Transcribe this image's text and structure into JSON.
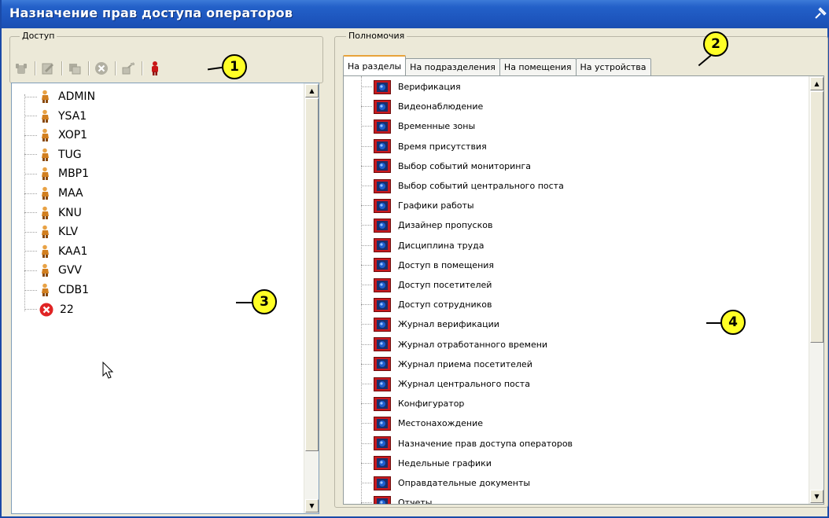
{
  "window": {
    "title": "Назначение прав доступа операторов"
  },
  "access_group": {
    "legend": "Доступ",
    "toolbar": [
      {
        "icon": "add-operator-icon",
        "enabled": false
      },
      {
        "icon": "edit-operator-icon",
        "enabled": false
      },
      {
        "icon": "copy-rights-icon",
        "enabled": false
      },
      {
        "icon": "delete-icon",
        "enabled": false
      },
      {
        "icon": "password-icon",
        "enabled": false
      },
      {
        "icon": "operator-red-icon",
        "enabled": true
      }
    ],
    "operators": [
      {
        "name": "ADMIN",
        "icon": "operator-icon"
      },
      {
        "name": "YSA1",
        "icon": "operator-icon"
      },
      {
        "name": "XOP1",
        "icon": "operator-icon"
      },
      {
        "name": "TUG",
        "icon": "operator-icon"
      },
      {
        "name": "MBP1",
        "icon": "operator-icon"
      },
      {
        "name": "MAA",
        "icon": "operator-icon"
      },
      {
        "name": "KNU",
        "icon": "operator-icon"
      },
      {
        "name": "KLV",
        "icon": "operator-icon"
      },
      {
        "name": "KAA1",
        "icon": "operator-icon"
      },
      {
        "name": "GVV",
        "icon": "operator-icon"
      },
      {
        "name": "CDB1",
        "icon": "operator-icon"
      },
      {
        "name": "22",
        "icon": "error-icon"
      }
    ]
  },
  "rights_group": {
    "legend": "Полномочия",
    "tabs": [
      {
        "label": "На разделы",
        "active": true
      },
      {
        "label": "На подразделения",
        "active": false
      },
      {
        "label": "На помещения",
        "active": false
      },
      {
        "label": "На устройства",
        "active": false
      }
    ],
    "sections": [
      "Верификация",
      "Видеонаблюдение",
      "Временные зоны",
      "Время присутствия",
      "Выбор событий мониторинга",
      "Выбор событий центрального поста",
      "Графики работы",
      "Дизайнер пропусков",
      "Дисциплина труда",
      "Доступ в помещения",
      "Доступ посетителей",
      "Доступ сотрудников",
      "Журнал верификации",
      "Журнал отработанного времени",
      "Журнал приема посетителей",
      "Журнал центрального поста",
      "Конфигуратор",
      "Местонахождение",
      "Назначение прав доступа операторов",
      "Недельные графики",
      "Оправдательные документы",
      "Отчеты"
    ]
  },
  "callouts": [
    "1",
    "2",
    "3",
    "4"
  ],
  "colors": {
    "titlebar": "#1d55bd",
    "callout_fill": "#ffff26",
    "section_icon_red": "#c8191e",
    "section_icon_blue": "#1e5fd0"
  }
}
